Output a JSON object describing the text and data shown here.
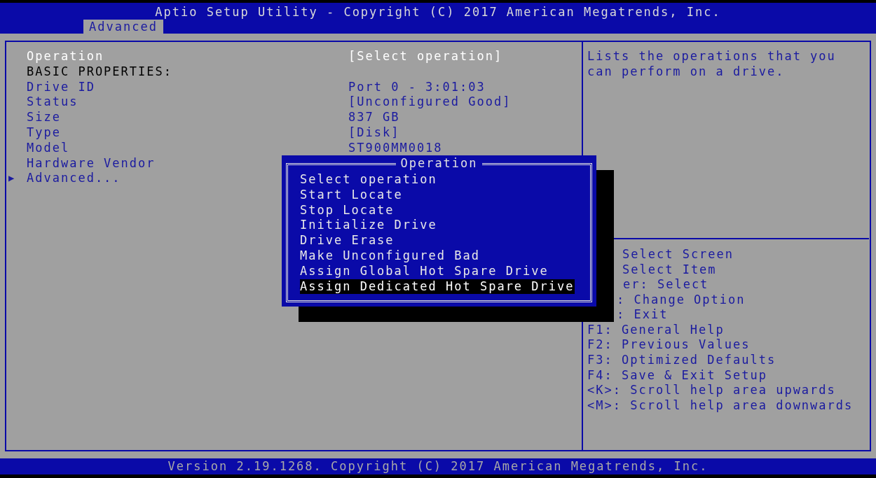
{
  "window": {
    "title": "Aptio Setup Utility - Copyright (C) 2017 American Megatrends, Inc."
  },
  "tabs": [
    {
      "label": "Advanced",
      "selected": true
    }
  ],
  "settings": [
    {
      "kind": "option",
      "label": "Operation",
      "value": "[Select operation]",
      "selected": true
    },
    {
      "kind": "heading",
      "label": "BASIC PROPERTIES:"
    },
    {
      "kind": "info",
      "label": "Drive ID",
      "value": "Port 0 - 3:01:03"
    },
    {
      "kind": "info",
      "label": "Status",
      "value": "[Unconfigured Good]"
    },
    {
      "kind": "info",
      "label": "Size",
      "value": "837 GB"
    },
    {
      "kind": "info",
      "label": "Type",
      "value": "[Disk]"
    },
    {
      "kind": "info",
      "label": "Model",
      "value": "ST900MM0018"
    },
    {
      "kind": "info",
      "label": "Hardware Vendor"
    },
    {
      "kind": "submenu",
      "marker": "▶",
      "label": "Advanced..."
    }
  ],
  "help": {
    "text": "Lists the operations that you can perform on a drive.",
    "keys": [
      "Select Screen",
      "Select Item",
      "er: Select",
      ": Change Option",
      ": Exit",
      "F1: General Help",
      "F2: Previous Values",
      "F3: Optimized Defaults",
      "F4: Save & Exit Setup",
      "<K>: Scroll help area upwards",
      "<M>: Scroll help area downwards"
    ]
  },
  "popup": {
    "title": "Operation",
    "options": [
      {
        "label": "Select operation",
        "selected": false
      },
      {
        "label": "Start Locate",
        "selected": false
      },
      {
        "label": "Stop Locate",
        "selected": false
      },
      {
        "label": "Initialize Drive",
        "selected": false
      },
      {
        "label": "Drive Erase",
        "selected": false
      },
      {
        "label": "Make Unconfigured Bad",
        "selected": false
      },
      {
        "label": "Assign Global Hot Spare Drive",
        "selected": false
      },
      {
        "label": "Assign Dedicated Hot Spare Drive",
        "selected": true
      }
    ]
  },
  "status_bar": {
    "text": "Version 2.19.1268. Copyright (C) 2017 American Megatrends, Inc."
  }
}
